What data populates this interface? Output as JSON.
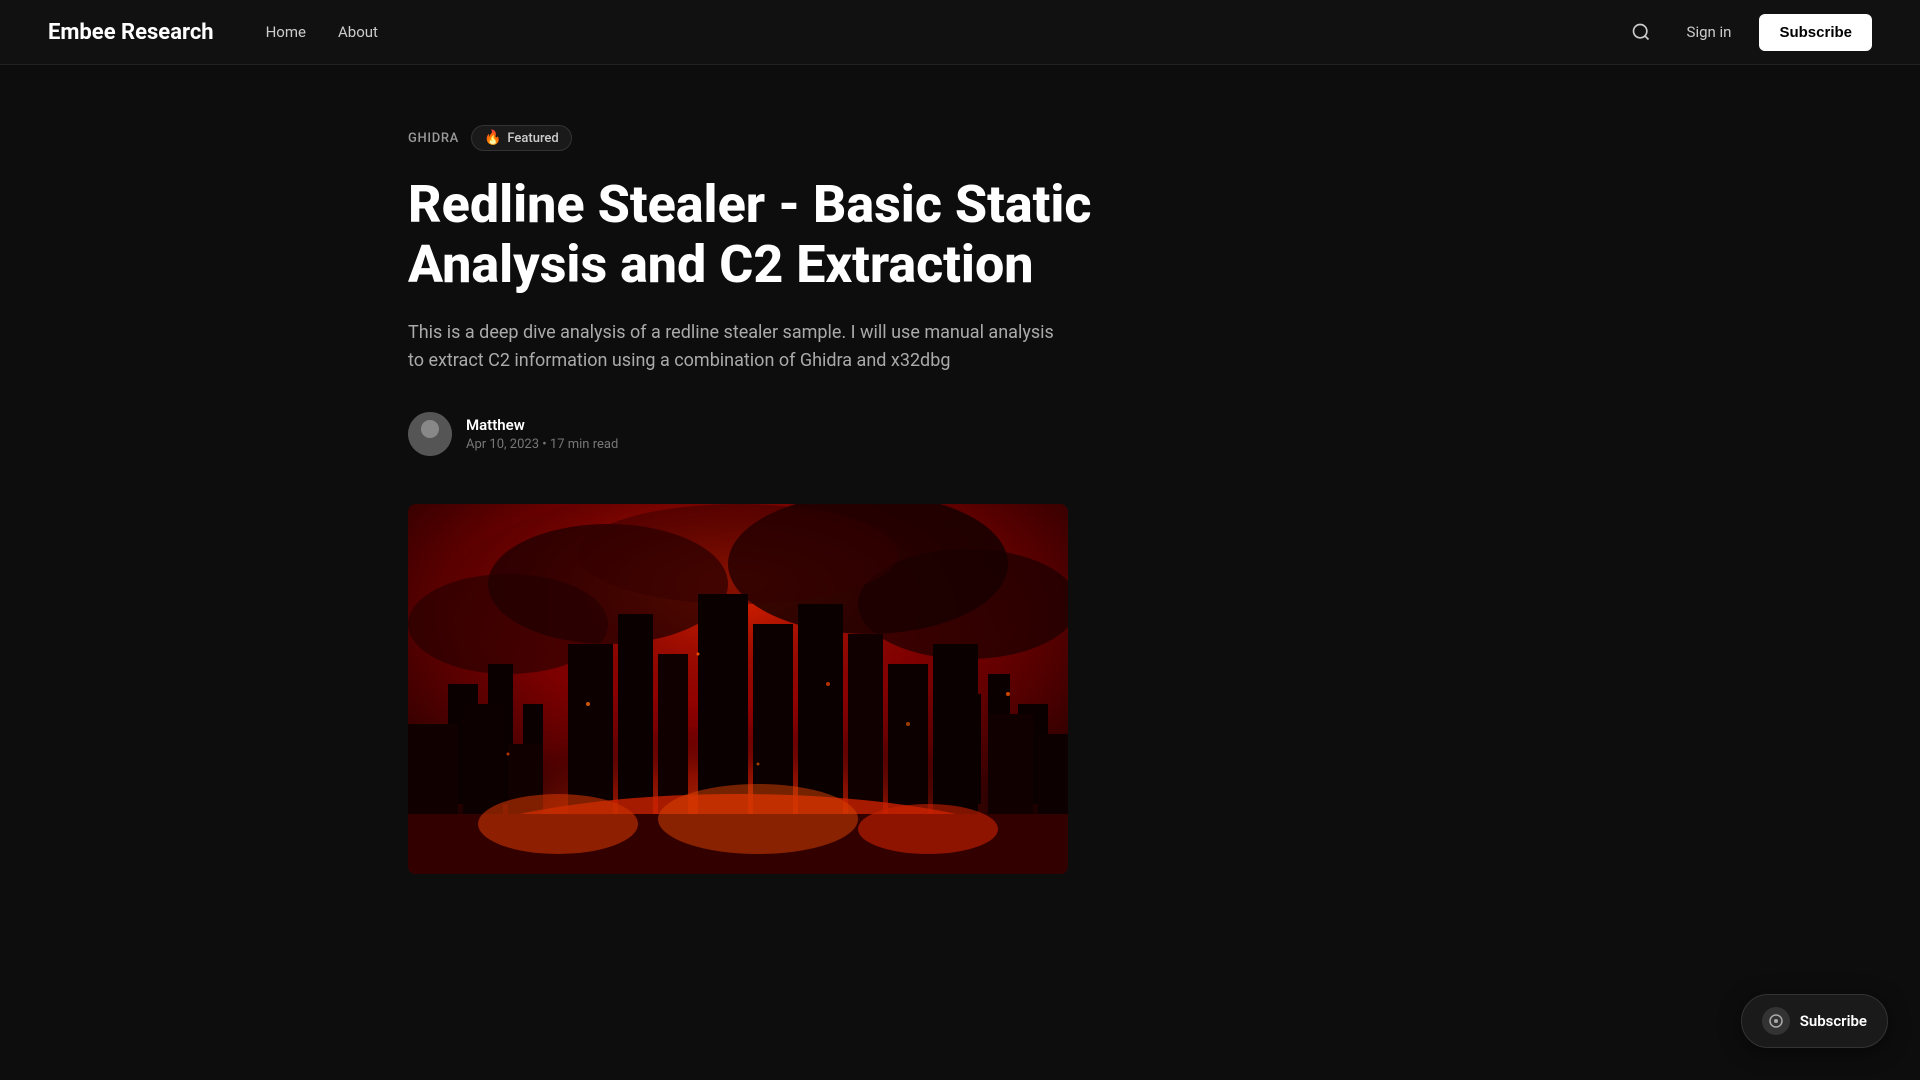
{
  "site": {
    "title": "Embee Research",
    "bg_color": "#0d0d0d",
    "header_bg": "#111111"
  },
  "nav": {
    "home_label": "Home",
    "about_label": "About"
  },
  "header": {
    "signin_label": "Sign in",
    "subscribe_label": "Subscribe"
  },
  "article": {
    "tag": "Ghidra",
    "featured_label": "Featured",
    "title": "Redline Stealer - Basic Static Analysis and C2 Extraction",
    "excerpt": "This is a deep dive analysis of a redline stealer sample. I will use manual analysis to extract C2 information using a combination of Ghidra and x32dbg",
    "author_name": "Matthew",
    "date": "Apr 10, 2023",
    "read_time": "17 min read",
    "meta_separator": "•"
  },
  "floating": {
    "subscribe_label": "Subscribe"
  },
  "icons": {
    "search": "search-icon",
    "fire": "🔥",
    "avatar": "person-icon"
  }
}
